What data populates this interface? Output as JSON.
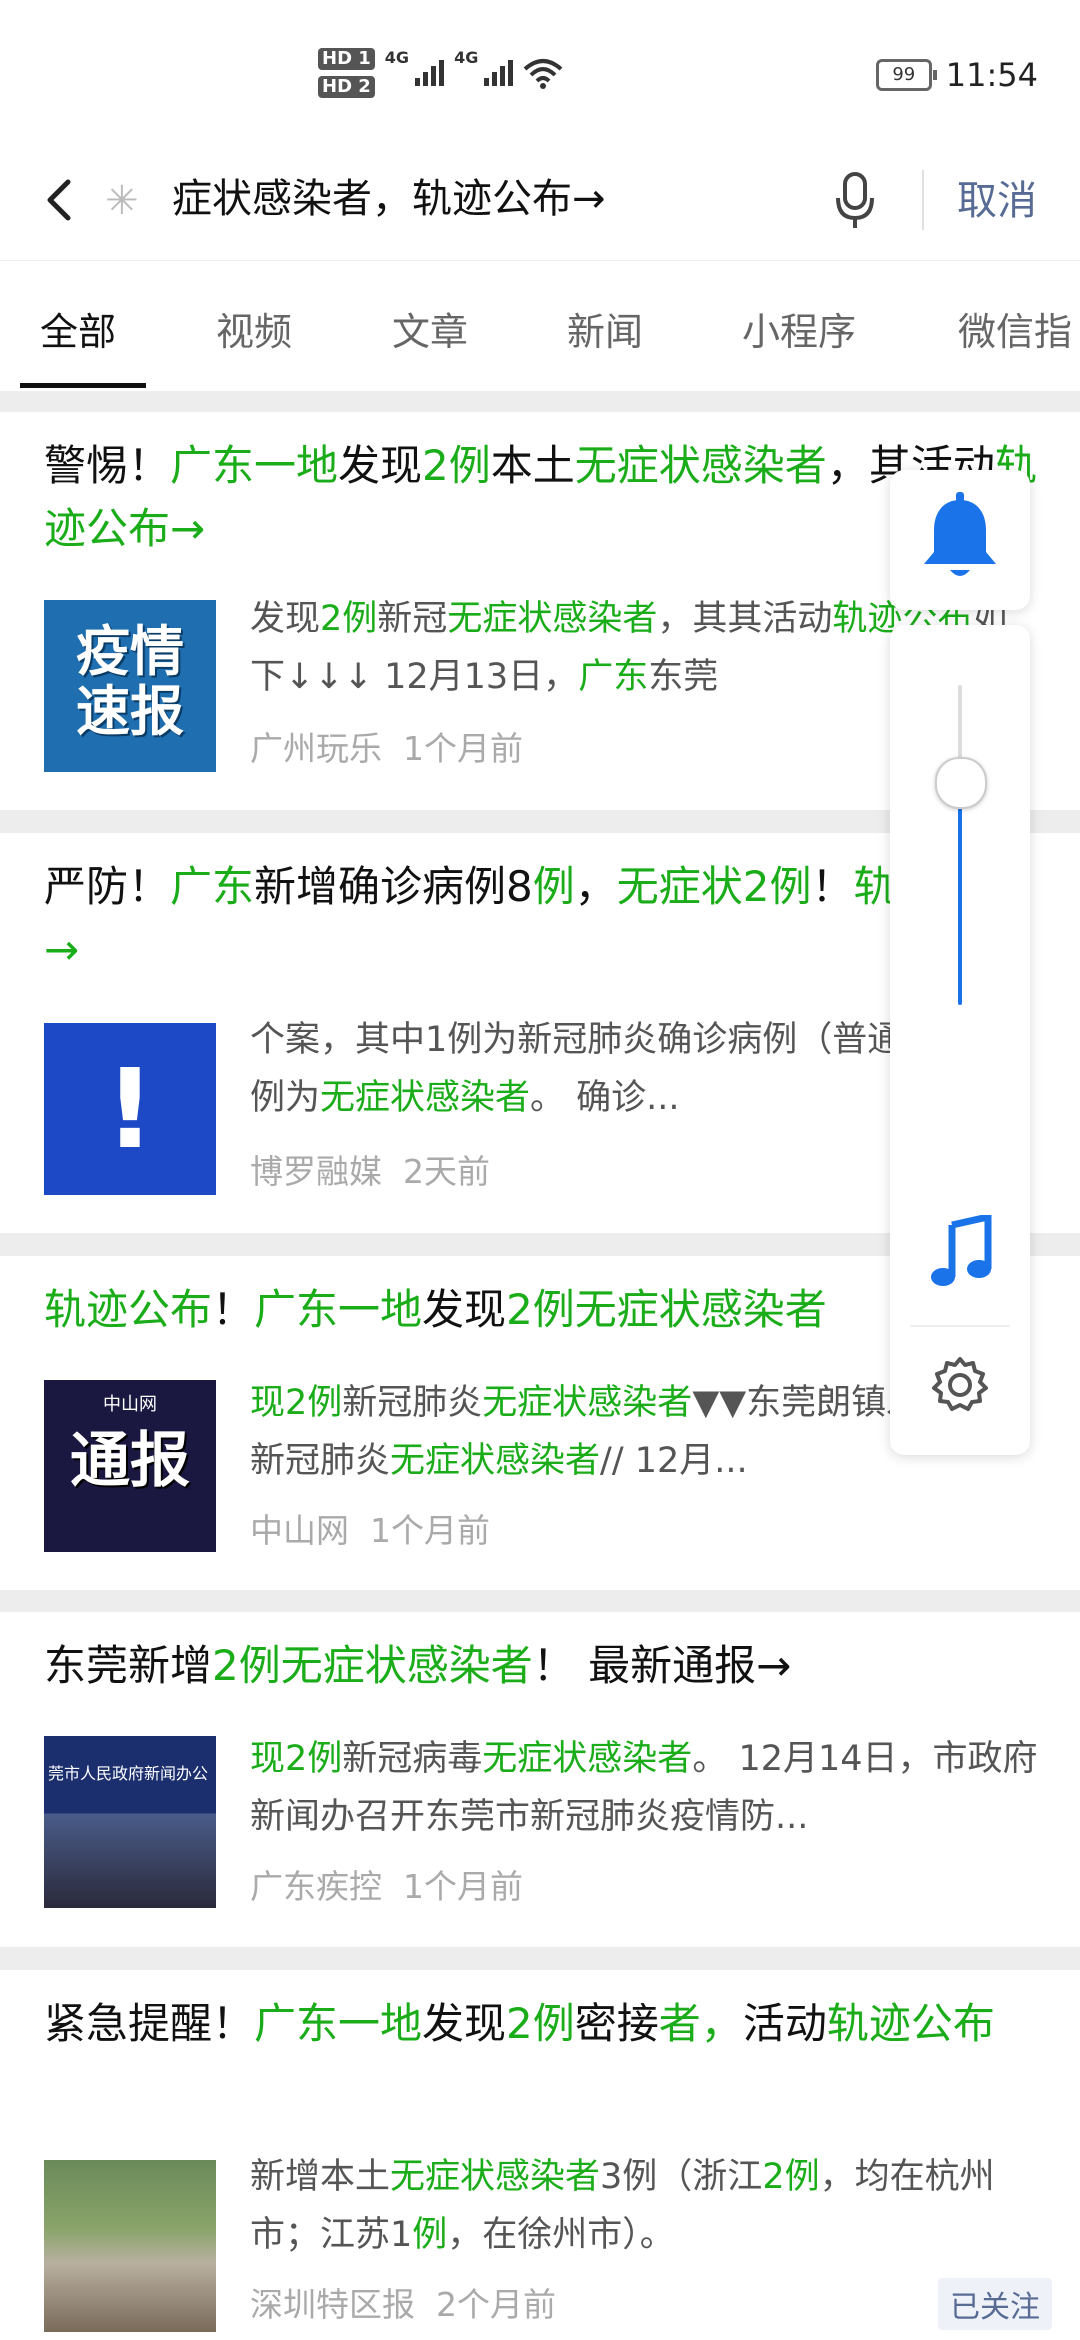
{
  "status": {
    "hd1": "HD 1",
    "hd2": "HD 2",
    "net1": "4G",
    "net2": "4G",
    "battery": "99",
    "time": "11:54"
  },
  "search": {
    "query": "症状感染者，轨迹公布→",
    "cancel": "取消"
  },
  "tabs": [
    "全部",
    "视频",
    "文章",
    "新闻",
    "小程序",
    "微信指"
  ],
  "results": [
    {
      "title": [
        [
          "警惕！",
          ""
        ],
        [
          "广东一地",
          "g"
        ],
        [
          "发现",
          ""
        ],
        [
          "2例",
          "g"
        ],
        [
          "本土",
          ""
        ],
        [
          "无症状感染者",
          "g"
        ],
        [
          "，其活动",
          ""
        ],
        [
          "轨迹公布→",
          "g"
        ]
      ],
      "thumb_text": [
        "疫情",
        "速报"
      ],
      "snippet": [
        [
          "发现",
          ""
        ],
        [
          "2例",
          "g"
        ],
        [
          "新冠",
          ""
        ],
        [
          "无症状感染者",
          "g"
        ],
        [
          "，其其活动",
          ""
        ],
        [
          "轨迹公布",
          "g"
        ],
        [
          "如下↓↓↓ 12月13日，",
          ""
        ],
        [
          "广东",
          "g"
        ],
        [
          "东莞",
          ""
        ]
      ],
      "source": "广州玩乐",
      "time": "1个月前"
    },
    {
      "title": [
        [
          "严防！",
          ""
        ],
        [
          "广东",
          "g"
        ],
        [
          "新增确诊病例8",
          ""
        ],
        [
          "例",
          "g"
        ],
        [
          "，",
          ""
        ],
        [
          "无症状2例",
          "g"
        ],
        [
          "！",
          ""
        ],
        [
          "轨迹公布→",
          "g"
        ]
      ],
      "thumb_text": [
        "!"
      ],
      "snippet": [
        [
          "个案，其中1例为新冠肺炎确诊病例（普通型），6例为",
          ""
        ],
        [
          "无症状感染者",
          "g"
        ],
        [
          "。 确诊...",
          ""
        ]
      ],
      "source": "博罗融媒",
      "time": "2天前"
    },
    {
      "title": [
        [
          "轨迹公布",
          "g"
        ],
        [
          "！",
          ""
        ],
        [
          "广东一地",
          "g"
        ],
        [
          "发现",
          ""
        ],
        [
          "2例无症状感染者",
          "g"
        ]
      ],
      "thumb_text": [
        "中山网",
        "通报"
      ],
      "snippet": [
        [
          "现2例",
          "g"
        ],
        [
          "新冠肺炎",
          ""
        ],
        [
          "无症状感染者",
          "g"
        ],
        [
          "▼▼东莞",
          ""
        ],
        [
          "朗镇发现",
          ""
        ],
        [
          "2例",
          "g"
        ],
        [
          "新冠肺炎",
          ""
        ],
        [
          "无症状感染者",
          "g"
        ],
        [
          "// 12月...",
          ""
        ]
      ],
      "source": "中山网",
      "time": "1个月前"
    },
    {
      "title": [
        [
          "东莞新增",
          ""
        ],
        [
          "2例无症状感染者",
          "g"
        ],
        [
          "！ 最新通报→",
          ""
        ]
      ],
      "thumb_text": [
        "莞市人民政府新闻办公"
      ],
      "snippet": [
        [
          "现2例",
          "g"
        ],
        [
          "新冠病毒",
          ""
        ],
        [
          "无症状感染者",
          "g"
        ],
        [
          "。 12月14日，市政府新闻办召开东莞市新冠肺炎疫情防...",
          ""
        ]
      ],
      "source": "广东疾控",
      "time": "1个月前"
    },
    {
      "title": [
        [
          "紧急提醒！",
          ""
        ],
        [
          "广东一地",
          "g"
        ],
        [
          "发现",
          ""
        ],
        [
          "2例",
          "g"
        ],
        [
          "密接",
          ""
        ],
        [
          "者，",
          "g"
        ],
        [
          "活动",
          ""
        ],
        [
          "轨迹公布",
          "g"
        ]
      ],
      "thumb_text": [],
      "snippet": [
        [
          "新增本土",
          ""
        ],
        [
          "无症状感染者",
          "g"
        ],
        [
          "3例（浙江",
          ""
        ],
        [
          "2例",
          "g"
        ],
        [
          "，均在杭州市；江苏1",
          ""
        ],
        [
          "例",
          "g"
        ],
        [
          "，在徐州市）。",
          ""
        ]
      ],
      "source": "深圳特区报",
      "time": "2个月前",
      "follow": "已关注"
    }
  ],
  "volume_level": 0.7
}
